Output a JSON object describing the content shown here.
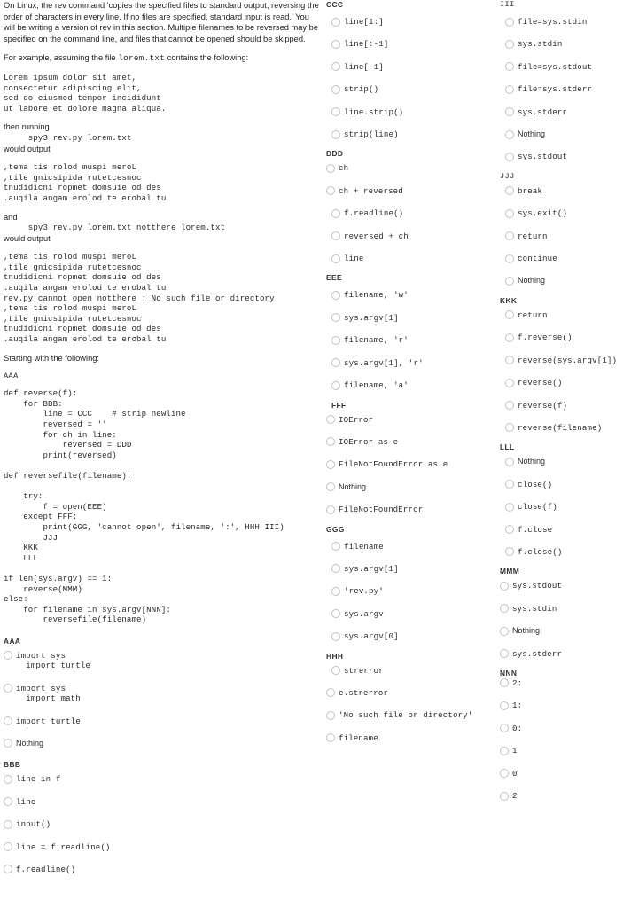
{
  "document": {
    "intro_paragraph_1": "On Linux, the rev command 'copies the specified files to standard output, reversing the order of characters in every line. If no files are specified, standard input is read.' You will be writing a version of rev in this section. Multiple filenames to be reversed may be specified on the command line, and files that cannot be opened should be skipped.",
    "intro_paragraph_2_pre": "For example, assuming the file ",
    "intro_paragraph_2_mono": "lorem.txt",
    "intro_paragraph_2_post": " contains the following:",
    "lorem_block": "Lorem ipsum dolor sit amet,\nconsectetur adipiscing elit,\nsed do eiusmod tempor incididunt\nut labore et dolore magna aliqua.",
    "then_running_label": "then running",
    "run_command_1": "     spy3 rev.py lorem.txt",
    "would_output_label_1": "would output",
    "output_block_1": ",tema tis rolod muspi meroL\n,tile gnicsipida rutetcesnoc\ntnudidicni ropmet domsuie od des\n.auqila angam erolod te erobal tu",
    "and_label": "and",
    "run_command_2": "     spy3 rev.py lorem.txt notthere lorem.txt",
    "would_output_label_2": "would output",
    "output_block_2": ",tema tis rolod muspi meroL\n,tile gnicsipida rutetcesnoc\ntnudidicni ropmet domsuie od des\n.auqila angam erolod te erobal tu\nrev.py cannot open notthere : No such file or directory\n,tema tis rolod muspi meroL\n,tile gnicsipida rutetcesnoc\ntnudidicni ropmet domsuie od des\n.auqila angam erolod te erobal tu",
    "starting_with_label": "Starting with the following:",
    "code_marker_aaa": "AAA",
    "code_block_main": "def reverse(f):\n    for BBB:\n        line = CCC    # strip newline\n        reversed = ''\n        for ch in line:\n            reversed = DDD\n        print(reversed)\n\ndef reversefile(filename):\n\n    try:\n        f = open(EEE)\n    except FFF:\n        print(GGG, 'cannot open', filename, ':', HHH III)\n        JJJ\n    KKK\n    LLL\n\nif len(sys.argv) == 1:\n    reverse(MMM)\nelse:\n    for filename in sys.argv[NNN]:\n        reversefile(filename)"
  },
  "groups": {
    "AAA": {
      "label": "AAA",
      "options": [
        "import sys\n  import turtle",
        "import sys\n  import math",
        "import turtle",
        "Nothing"
      ]
    },
    "BBB": {
      "label": "BBB",
      "options": [
        "line in f",
        "line",
        "input()",
        "line = f.readline()",
        "f.readline()"
      ]
    },
    "CCC": {
      "label": "CCC",
      "options": [
        "line[1:]",
        "line[:-1]",
        "line[-1]",
        "strip()",
        "line.strip()",
        "strip(line)"
      ]
    },
    "DDD": {
      "label": "DDD",
      "options": [
        "ch",
        "ch + reversed",
        "f.readline()",
        "reversed + ch",
        "line"
      ]
    },
    "EEE": {
      "label": "EEE",
      "options": [
        "filename, 'w'",
        "sys.argv[1]",
        "filename, 'r'",
        "sys.argv[1], 'r'",
        "filename, 'a'"
      ]
    },
    "FFF": {
      "label": "FFF",
      "options": [
        "IOError",
        "IOError as e",
        "FileNotFoundError as e",
        "Nothing",
        "FileNotFoundError"
      ]
    },
    "GGG": {
      "label": "GGG",
      "options": [
        "filename",
        "sys.argv[1]",
        "'rev.py'",
        "sys.argv",
        "sys.argv[0]"
      ]
    },
    "HHH": {
      "label": "HHH",
      "options": [
        "strerror",
        "e.strerror",
        "'No such file or directory'",
        "filename"
      ]
    },
    "III": {
      "label": "III",
      "options": [
        "file=sys.stdin",
        "sys.stdin",
        "file=sys.stdout",
        "file=sys.stderr",
        "sys.stderr",
        "Nothing",
        "sys.stdout"
      ]
    },
    "JJJ": {
      "label": "JJJ",
      "options": [
        "break",
        "sys.exit()",
        "return",
        "continue",
        "Nothing"
      ]
    },
    "KKK": {
      "label": "KKK",
      "options": [
        "return",
        "f.reverse()",
        "reverse(sys.argv[1])",
        "reverse()",
        "reverse(f)",
        "reverse(filename)"
      ]
    },
    "LLL": {
      "label": "LLL",
      "options": [
        "Nothing",
        "close()",
        "close(f)",
        "f.close",
        "f.close()"
      ]
    },
    "MMM": {
      "label": "MMM",
      "options": [
        "sys.stdout",
        "sys.stdin",
        "Nothing",
        "sys.stderr"
      ]
    },
    "NNN": {
      "label": "NNN",
      "options": [
        "2:",
        "1:",
        "0:",
        "1",
        "0",
        "2"
      ]
    }
  }
}
